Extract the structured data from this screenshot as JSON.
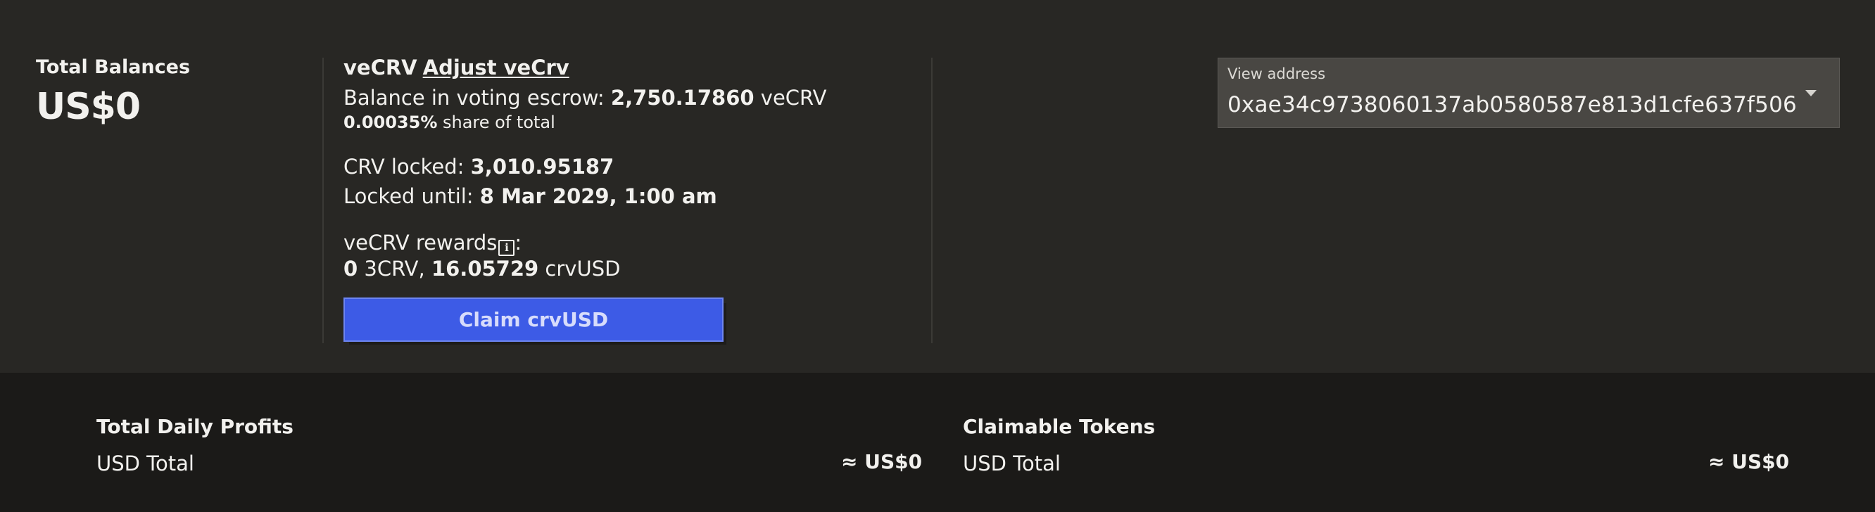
{
  "balances": {
    "title": "Total Balances",
    "value": "US$0"
  },
  "vecrv": {
    "title": "veCRV",
    "adjust_link": "Adjust veCrv",
    "balance_label": "Balance in voting escrow: ",
    "balance_value": "2,750.17860",
    "balance_unit": " veCRV",
    "share_value": "0.00035%",
    "share_label": " share of total",
    "crv_locked_label": "CRV locked: ",
    "crv_locked_value": "3,010.95187",
    "locked_until_label": "Locked until: ",
    "locked_until_value": "8 Mar 2029, 1:00 am",
    "rewards_label": "veCRV rewards",
    "rewards_icon": "i",
    "rewards_colon": ":",
    "reward_3crv_value": "0",
    "reward_3crv_unit": " 3CRV, ",
    "reward_crvusd_value": "16.05729",
    "reward_crvusd_unit": " crvUSD",
    "claim_button": "Claim crvUSD"
  },
  "address": {
    "label": "View address",
    "value": "0xae34c9738060137ab0580587e813d1cfe637f506"
  },
  "daily_profits": {
    "title": "Total Daily Profits",
    "row_label": "USD Total",
    "row_value": "≈ US$0"
  },
  "claimable": {
    "title": "Claimable Tokens",
    "row_label": "USD Total",
    "row_value": "≈ US$0"
  },
  "colors": {
    "top_bg": "#282724",
    "bottom_bg": "#1b1a18",
    "button_bg": "#3d5be6",
    "address_bg": "#494743"
  }
}
